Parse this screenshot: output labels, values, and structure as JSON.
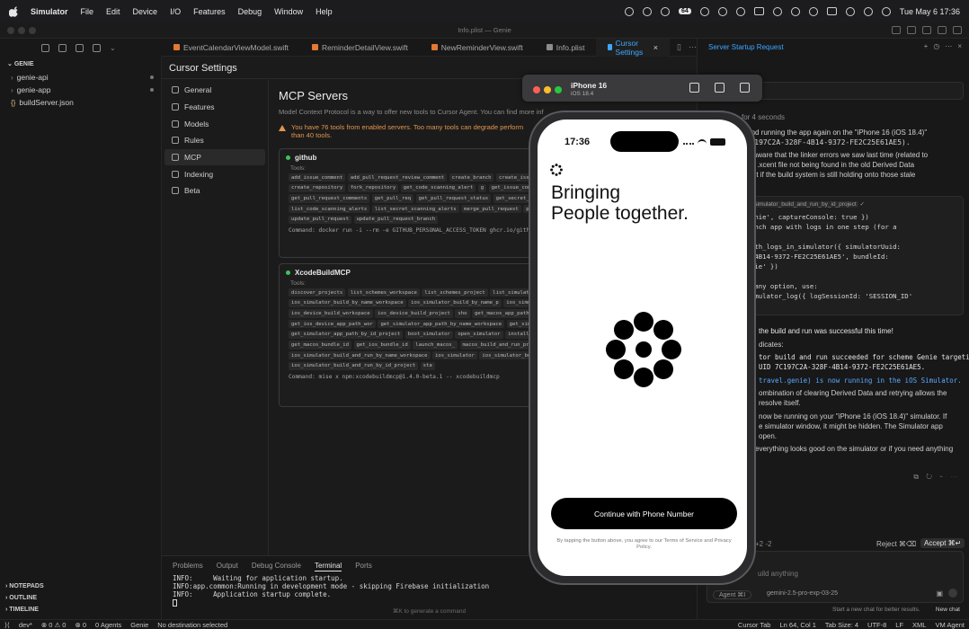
{
  "menubar": {
    "app": "Simulator",
    "items": [
      "File",
      "Edit",
      "Device",
      "I/O",
      "Features",
      "Debug",
      "Window",
      "Help"
    ],
    "battery_badge": "64",
    "datetime": "Tue May 6  17:36"
  },
  "window": {
    "title": "Info.plist — Genie"
  },
  "tabs": [
    {
      "label": "EventCalendarViewModel.swift"
    },
    {
      "label": "ReminderDetailView.swift"
    },
    {
      "label": "NewReminderView.swift"
    },
    {
      "label": "Info.plist"
    },
    {
      "label": "Cursor Settings",
      "close": "×"
    }
  ],
  "explorer": {
    "root": "GENIE",
    "items": [
      {
        "label": "genie-api",
        "chevron": "›"
      },
      {
        "label": "genie-app",
        "chevron": "›"
      },
      {
        "label": "buildServer.json",
        "icon": "{}"
      }
    ],
    "sections": [
      "NOTEPADS",
      "OUTLINE",
      "TIMELINE"
    ]
  },
  "settings": {
    "title": "Cursor Settings",
    "nav": [
      "General",
      "Features",
      "Models",
      "Rules",
      "MCP",
      "Indexing",
      "Beta"
    ],
    "active": "MCP",
    "heading": "MCP Servers",
    "description": "Model Context Protocol is a way to offer new tools to Cursor Agent. You can find more inf",
    "warning": "You have 76 tools from enabled servers. Too many tools can degrade perform",
    "warning2": "than 40 tools.",
    "tools_label": "Tools:",
    "servers": [
      {
        "name": "github",
        "tools": [
          "add_issue_comment",
          "add_pull_request_review_comment",
          "create_branch",
          "create_issue",
          "creat",
          "create_pull_request_review",
          "create_repository",
          "fork_repository",
          "get_code_scanning_alert",
          "g",
          "get_issue_comments",
          "get_me",
          "get_pull_request",
          "get_pull_request_comments",
          "get_pull_req",
          "get_pull_request_status",
          "get_secret_scanning_alert",
          "list_branches",
          "list_code_scanning_alerts",
          "list_secret_scanning_alerts",
          "merge_pull_request",
          "push_files",
          "search_code",
          "search_issues",
          "update_pull_request",
          "update_pull_request_branch"
        ],
        "command": "Command:   docker run -i --rm -e GITHUB_PERSONAL_ACCESS_TOKEN ghcr.io/github/g"
      },
      {
        "name": "XcodeBuildMCP",
        "tools": [
          "discover_projects",
          "list_schemes_workspace",
          "list_schemes_project",
          "list_simulators",
          "clean_wo",
          "macos_build_project",
          "ios_simulator_build_by_name_workspace",
          "ios_simulator_build_by_name_p",
          "ios_simulator_build_by_id_project",
          "ios_device_build_workspace",
          "ios_device_build_project",
          "sho",
          "get_macos_app_path_workspace",
          "get_macos_app_path_project",
          "get_ios_device_app_path_wor",
          "get_simulator_app_path_by_name_workspace",
          "get_simulator_app_path_by_name_project",
          "get_si",
          "get_simulator_app_path_by_id_project",
          "boot_simulator",
          "open_simulator",
          "install_app_in_simula",
          "launch_app_with_logs_in_simulator",
          "get_macos_bundle_id",
          "get_ios_bundle_id",
          "launch_macos_",
          "macos_build_and_run_project",
          "ios_simulator_build_and_run_by_name_workspace",
          "ios_simulator",
          "ios_simulator_build_and_run_by_id_workspace",
          "ios_simulator_build_and_run_by_id_project",
          "sta"
        ],
        "command": "Command:   mise x npm:xcodebuildmcp@1.4.0-beta.1 -- xcodebuildmcp"
      }
    ]
  },
  "panel": {
    "tabs": [
      "Problems",
      "Output",
      "Debug Console",
      "Terminal",
      "Ports"
    ],
    "active": "Terminal",
    "terminal": [
      "INFO:     Waiting for application startup.",
      "INFO:app.common:Running in development mode - skipping Firebase initialization",
      "INFO:     Application startup complete."
    ],
    "hint": "⌘K to generate a command"
  },
  "chat": {
    "title": "Server Startup Request",
    "thought": "for 4 seconds",
    "p1": [
      "ng and running the app again on the \"iPhone 16 (iOS 18.4)\"",
      ": 7C197C2A-328F-4B14-9372-FE2C25E61AE5)."
    ],
    "p2": [
      "e be aware that the linker errors we saw last time (related to",
      "ed an .xcent file not being found in the old Derived Data",
      "persist if the build system is still holding onto those stale"
    ],
    "tool_name": "ios_simulator_build_and_run_by_id_project",
    "tool_label": "tool",
    "code": [
      "vel.genie', captureConsole: true })",
      "3: Launch app with logs in one step (for a",
      "rt):",
      "app_with_logs_in_simulator({ simulatorUuid:",
      "-328F-4B14-9372-FE2C25E61AE5', bundleId:",
      "el.genie' })",
      "",
      " with any option, use:",
      "get_simulator_log({ logSessionId: 'SESSION_ID'"
    ],
    "p3": "the build and run was successful this time!",
    "p4": "dicates:",
    "code2": [
      "tor build and run succeeded for scheme Genie targetin",
      "UID 7C197C2A-328F-4B14-9372-FE2C25E61AE5."
    ],
    "p5": "travel.genie) is now running in the iOS Simulator.",
    "p6": [
      "ombination of clearing Derived Data and retrying allows the",
      "resolve itself."
    ],
    "p7": [
      "now be running on your \"iPhone 16 (iOS 18.4)\" simulator. If",
      "e simulator window, it might be hidden. The Simulator app",
      "open."
    ],
    "p8": "everything looks good on the simulator or if you need anything",
    "diff": "+2 -2",
    "reject": "Reject ⌘⌫",
    "accept": "Accept ⌘↵",
    "input_placeholder": "uild anything",
    "agent": "Agent ⌘I",
    "model": "gemini-2.5-pro-exp-03-25",
    "footer": "Start a new chat for better results.",
    "new_chat": "New chat"
  },
  "simulator": {
    "device": "iPhone 16",
    "ios": "iOS 18.4",
    "time": "17:36",
    "headline1": "Bringing",
    "headline2": "People together.",
    "cta": "Continue with Phone Number",
    "legal": "By tapping the button above, you agree to our Terms of Service and Privacy Policy."
  },
  "statusbar": {
    "left": [
      "dev*",
      "⊗ 0 ⚠ 0",
      "⊗ 0",
      "0 Agents",
      "Genie",
      "No destination selected"
    ],
    "right": [
      "Cursor Tab",
      "Ln 64, Col 1",
      "Tab Size: 4",
      "UTF-8",
      "LF",
      "XML",
      "VM Agent"
    ]
  }
}
